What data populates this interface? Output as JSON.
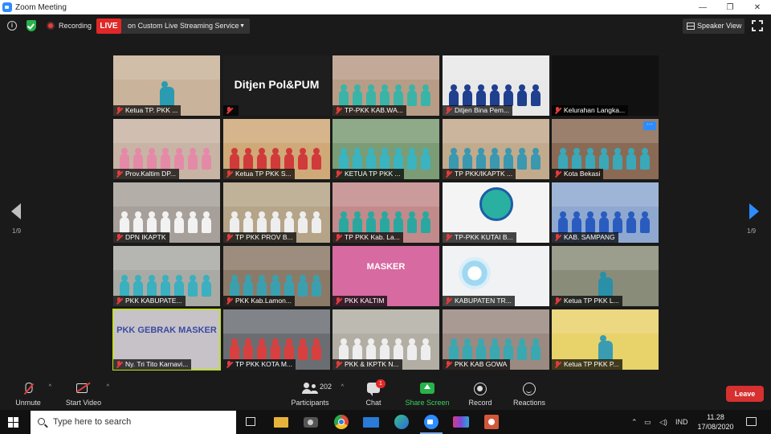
{
  "window": {
    "title": "Zoom Meeting",
    "buttons": [
      "—",
      "❐",
      "✕"
    ]
  },
  "topbar": {
    "recording_label": "Recording",
    "live_label": "LIVE",
    "stream_service": "on Custom Live Streaming Service",
    "view_mode": "Speaker View"
  },
  "gallery": {
    "page_left": "1/9",
    "page_right": "1/9",
    "tiles": [
      {
        "label": "Ketua TP. PKK ...",
        "bg": "#c9b39a",
        "fg": "#2a9bb0",
        "type": "person"
      },
      {
        "label": "",
        "bg": "#1e1e1e",
        "fg": "#ffffff",
        "type": "text",
        "text": "Ditjen Pol&PUM"
      },
      {
        "label": "TP-PKK KAB.WA...",
        "bg": "#b99c86",
        "fg": "#3bb4a8",
        "type": "group"
      },
      {
        "label": "Ditjen Bina Pem...",
        "bg": "#e8e8e8",
        "fg": "#1f3f8f",
        "type": "group"
      },
      {
        "label": "Kelurahan Langka...",
        "bg": "#111111",
        "fg": "#222222",
        "type": "dark"
      },
      {
        "label": "Prov.Kaltim DP...",
        "bg": "#c8b4a4",
        "fg": "#e48aa8",
        "type": "group"
      },
      {
        "label": "Ketua TP PKK S...",
        "bg": "#cfa978",
        "fg": "#d03a3a",
        "type": "group"
      },
      {
        "label": "KETUA TP PKK ...",
        "bg": "#7b9c74",
        "fg": "#3ab4c0",
        "type": "group"
      },
      {
        "label": "TP PKK/IKAPTK ...",
        "bg": "#c2aa8c",
        "fg": "#3a98b0",
        "type": "group"
      },
      {
        "label": "Kota Bekasi",
        "bg": "#8a6a54",
        "fg": "#3aa8b8",
        "type": "group",
        "more": "···"
      },
      {
        "label": "DPN IKAPTK",
        "bg": "#a7a09a",
        "fg": "#f2f2f2",
        "type": "group"
      },
      {
        "label": "TP PKK PROV B...",
        "bg": "#b5a488",
        "fg": "#eeeeee",
        "type": "group"
      },
      {
        "label": "TP PKK Kab. La...",
        "bg": "#c28a8a",
        "fg": "#2aa8a0",
        "type": "group"
      },
      {
        "label": "TP-PKK KUTAI B...",
        "bg": "#f4f4f4",
        "fg": "#1c5ca8",
        "type": "logo"
      },
      {
        "label": "KAB. SAMPANG",
        "bg": "#8fa8d0",
        "fg": "#2a5cc0",
        "type": "group"
      },
      {
        "label": "PKK KABUPATE...",
        "bg": "#a9aaa4",
        "fg": "#3ab0c0",
        "type": "group"
      },
      {
        "label": "PKK Kab.Lamon...",
        "bg": "#8c7a68",
        "fg": "#3aa0b0",
        "type": "group"
      },
      {
        "label": "PKK KALTIM",
        "bg": "#d76aa0",
        "fg": "#ffffff",
        "type": "text2",
        "text": "MASKER"
      },
      {
        "label": "KABUPATEN TR...",
        "bg": "#f0f2f4",
        "fg": "#3aa8d8",
        "type": "ring"
      },
      {
        "label": "Ketua TP PKK L...",
        "bg": "#8a8c7a",
        "fg": "#2a90a8",
        "type": "person"
      },
      {
        "label": "Ny. Tri Tito Karnavi...",
        "bg": "#c6c2c8",
        "fg": "#3a4aa0",
        "type": "text2",
        "text": "PKK GEBRAK MASKER",
        "active": true
      },
      {
        "label": "TP PKK KOTA M...",
        "bg": "#6a6e72",
        "fg": "#d84040",
        "type": "group"
      },
      {
        "label": "PKK & IKPTK N...",
        "bg": "#b2aea4",
        "fg": "#eeeeee",
        "type": "group"
      },
      {
        "label": "PKK KAB GOWA",
        "bg": "#9a8a82",
        "fg": "#3aa8b0",
        "type": "group"
      },
      {
        "label": "Ketua TP PKK P...",
        "bg": "#e8d26a",
        "fg": "#3a9cb0",
        "type": "person"
      }
    ]
  },
  "toolbar": {
    "unmute": "Unmute",
    "start_video": "Start Video",
    "participants": "Participants",
    "participant_count": "202",
    "chat": "Chat",
    "chat_badge": "1",
    "share_screen": "Share Screen",
    "record": "Record",
    "reactions": "Reactions",
    "leave": "Leave"
  },
  "taskbar": {
    "search_placeholder": "Type here to search",
    "language": "IND",
    "time": "11.28",
    "date": "17/08/2020"
  }
}
